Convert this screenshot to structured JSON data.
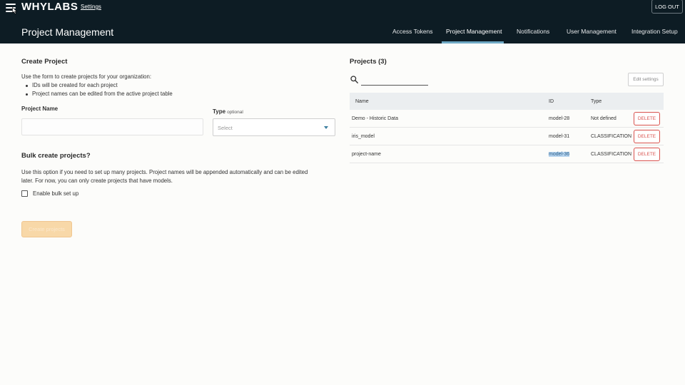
{
  "header": {
    "logo": "WHYLABS",
    "settings_link": "Settings",
    "logout_label": "LOG OUT",
    "page_title": "Project Management",
    "tabs": [
      {
        "label": "Access Tokens"
      },
      {
        "label": "Project Management"
      },
      {
        "label": "Notifications"
      },
      {
        "label": "User Management"
      },
      {
        "label": "Integration Setup"
      }
    ]
  },
  "create_project": {
    "title": "Create Project",
    "intro": "Use the form to create projects for your organization:",
    "bullets": [
      "IDs will be created for each project",
      "Project names can be edited from the active project table"
    ],
    "name_label": "Project Name",
    "name_value": "",
    "type_label": "Type",
    "type_optional": "optional",
    "type_placeholder": "Select"
  },
  "bulk": {
    "title": "Bulk create projects?",
    "description_line1": "Use this option if you need to set up many projects. Project names will be appended automatically and can be edited",
    "description_line2": "later. For now, you can only create projects that have models.",
    "checkbox_label": "Enable bulk set up",
    "checkbox_checked": false
  },
  "create_button_label": "Create projects",
  "projects": {
    "title": "Projects (3)",
    "search_value": "",
    "edit_settings_label": "Edit settings",
    "columns": [
      "Name",
      "ID",
      "Type"
    ],
    "delete_label": "DELETE",
    "rows": [
      {
        "name": "Demo - Historic Data",
        "id": "model-28",
        "type": "Not defined"
      },
      {
        "name": "iris_model",
        "id": "model-31",
        "type": "CLASSIFICATION"
      },
      {
        "name": "project-name",
        "id": "model-36",
        "type": "CLASSIFICATION"
      }
    ]
  },
  "colors": {
    "header_bg": "#0d1c24",
    "active_tab_underline": "#6ea8c4",
    "delete_red": "#d9534f",
    "create_button": "#f8d8a8",
    "id_highlight": "#b7d4ee"
  }
}
